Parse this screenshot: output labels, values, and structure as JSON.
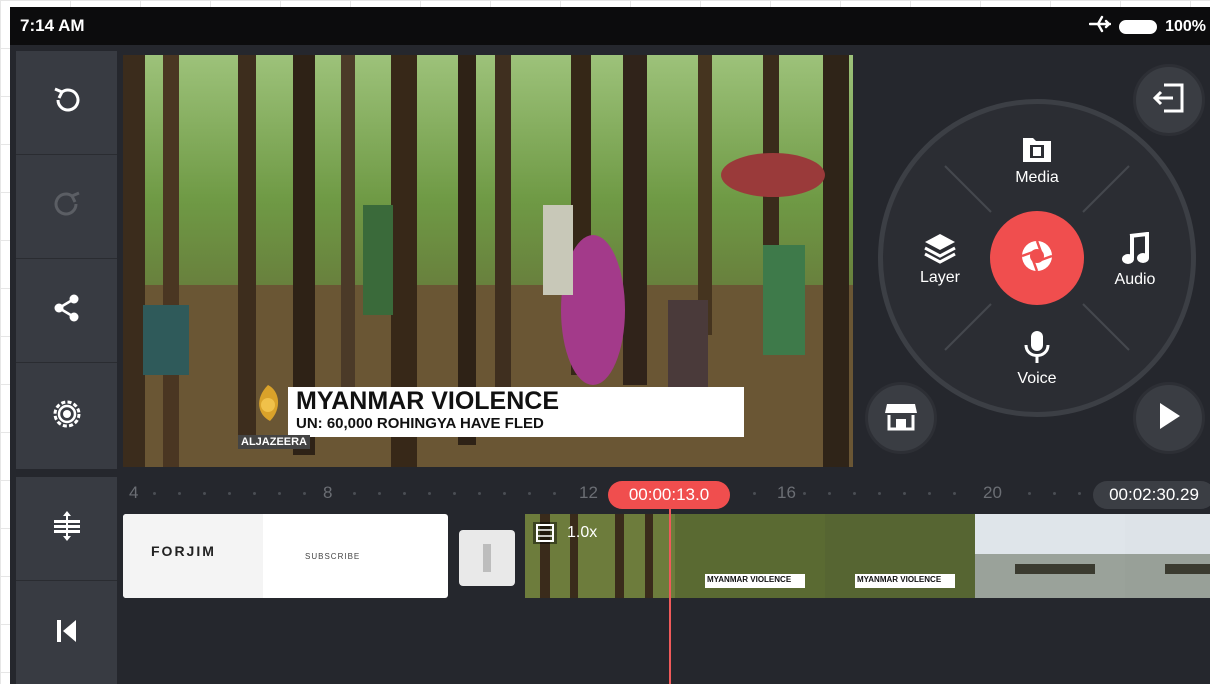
{
  "status_bar": {
    "time": "7:14 AM",
    "battery": "100%",
    "icons": [
      "airplane-icon",
      "battery-icon"
    ]
  },
  "left_toolbar": {
    "items": [
      {
        "name": "undo",
        "icon": "undo-icon",
        "enabled": true
      },
      {
        "name": "redo",
        "icon": "redo-icon",
        "enabled": false
      },
      {
        "name": "share",
        "icon": "share-icon",
        "enabled": true
      },
      {
        "name": "settings",
        "icon": "settings-icon",
        "enabled": true
      },
      {
        "name": "timeline-expand",
        "icon": "expand-vertical-icon",
        "enabled": true
      },
      {
        "name": "go-to-start",
        "icon": "skip-to-start-icon",
        "enabled": true
      }
    ]
  },
  "preview": {
    "headline": "MYANMAR VIOLENCE",
    "subheadline": "UN: 60,000 ROHINGYA HAVE FLED",
    "logo_text": "ALJAZEERA"
  },
  "media_wheel": {
    "top_label": "Media",
    "left_label": "Layer",
    "right_label": "Audio",
    "bottom_label": "Voice",
    "record_color": "#f04e4e"
  },
  "timeline": {
    "ruler_labels": [
      "4",
      "8",
      "12",
      "16",
      "20"
    ],
    "current_time": "00:00:13.0",
    "total_time": "00:02:30.29",
    "clips": [
      {
        "title": "FORJIM",
        "subtitle": "SUBSCRIBE"
      },
      {
        "speed": "1.0x"
      }
    ],
    "thumb_captions": [
      "MYANMAR VIOLENCE",
      "MYANMAR VIOLENCE"
    ]
  },
  "colors": {
    "accent": "#f04e4e",
    "panel": "#383b42",
    "background": "#25272d"
  }
}
